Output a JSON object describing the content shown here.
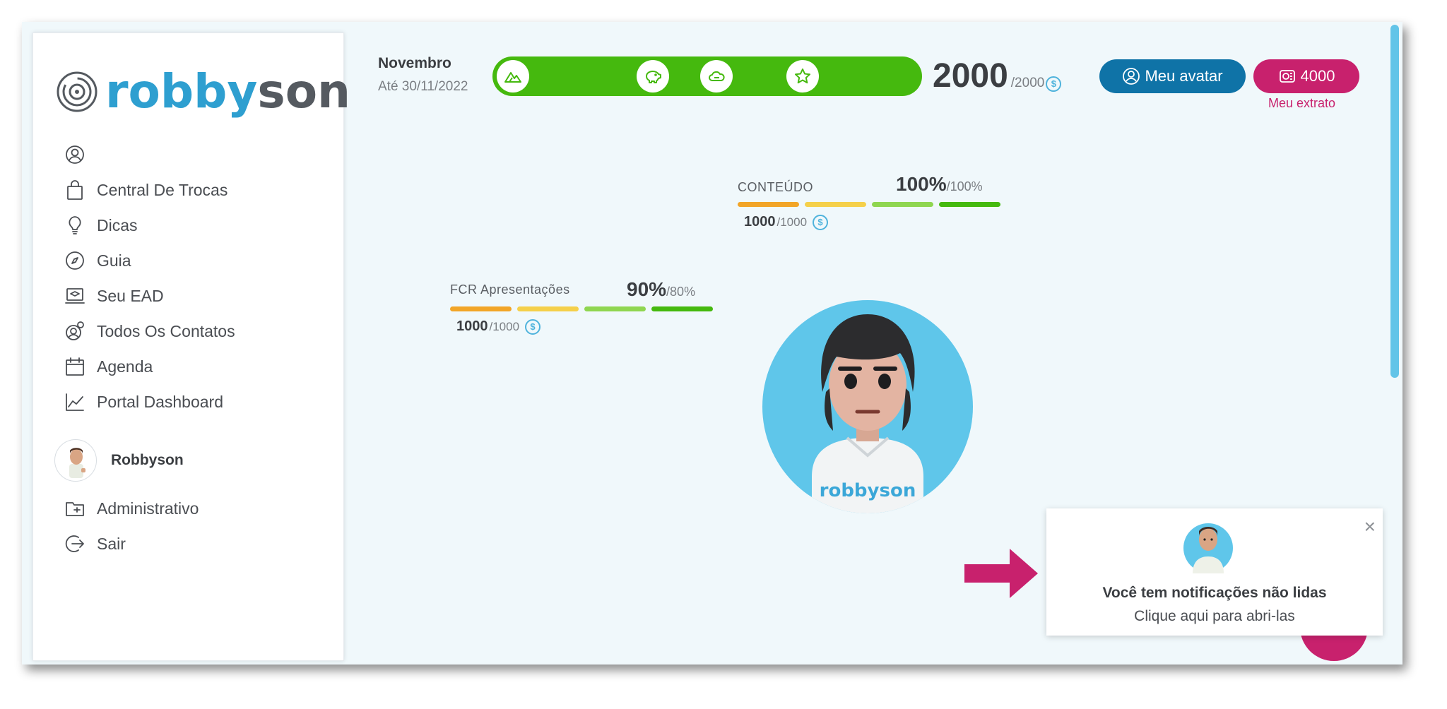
{
  "brand": {
    "logo_part1": "robby",
    "logo_part2": "son"
  },
  "sidebar": {
    "items": [
      {
        "label": "",
        "icon": "user-circle-icon"
      },
      {
        "label": "Central De Trocas",
        "icon": "shopping-bag-icon"
      },
      {
        "label": "Dicas",
        "icon": "lightbulb-icon"
      },
      {
        "label": "Guia",
        "icon": "compass-icon"
      },
      {
        "label": "Seu EAD",
        "icon": "laptop-graduation-icon"
      },
      {
        "label": "Todos Os Contatos",
        "icon": "contacts-icon"
      },
      {
        "label": "Agenda",
        "icon": "calendar-icon"
      },
      {
        "label": "Portal Dashboard",
        "icon": "chart-line-icon"
      }
    ],
    "user": {
      "name": "Robbyson"
    },
    "bottom_items": [
      {
        "label": "Administrativo",
        "icon": "admin-folder-icon"
      },
      {
        "label": "Sair",
        "icon": "logout-icon"
      }
    ]
  },
  "season": {
    "title": "Novembro",
    "date": "Até 30/11/2022"
  },
  "milestones": [
    "mountain-icon",
    "piggy-icon",
    "cloud-icon",
    "star-icon"
  ],
  "points": {
    "current": "2000",
    "total": "/2000",
    "coin_symbol": "$"
  },
  "buttons": {
    "avatar_label": "Meu avatar",
    "coins_label": "4000",
    "extrato_label": "Meu extrato"
  },
  "goals": [
    {
      "label": "CONTEÚDO",
      "pct": "100%",
      "pct_target": "/100%",
      "points": "1000",
      "points_total": "/1000"
    },
    {
      "label": "FCR Apresentações",
      "pct": "90%",
      "pct_target": "/80%",
      "points": "1000",
      "points_total": "/1000"
    }
  ],
  "avatar": {
    "shirt_text": "robbyson"
  },
  "colors": {
    "brand_blue": "#0f73a7",
    "brand_pink": "#c8216d",
    "progress_green": "#45b90e",
    "avatar_bg": "#5fc6ea"
  },
  "notification": {
    "title": "Você tem notificações não lidas",
    "subtitle": "Clique aqui para abri-las",
    "close": "×"
  }
}
